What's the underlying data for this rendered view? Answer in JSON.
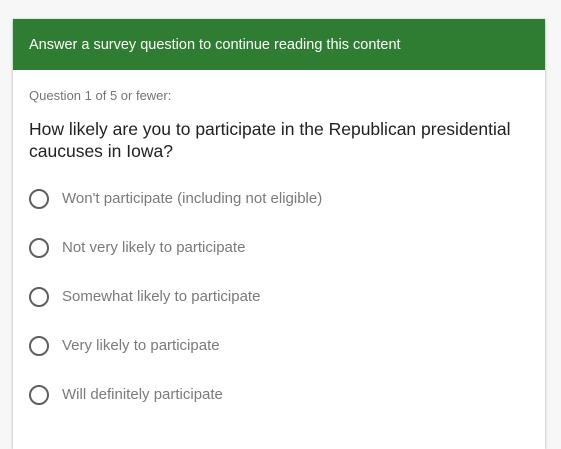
{
  "survey": {
    "header_title": "Answer a survey question to continue reading this content",
    "question_counter": "Question 1 of 5 or fewer:",
    "question": "How likely are you to participate in the Republican presidential caucuses in Iowa?",
    "options": [
      {
        "label": "Won't participate (including not eligible)"
      },
      {
        "label": "Not very likely to participate"
      },
      {
        "label": "Somewhat likely to participate"
      },
      {
        "label": "Very likely to participate"
      },
      {
        "label": "Will definitely participate"
      }
    ]
  },
  "colors": {
    "header_bg": "#2e7d32",
    "header_text": "#ffffff",
    "question_text": "#212121",
    "option_text": "#7a7a7a"
  }
}
